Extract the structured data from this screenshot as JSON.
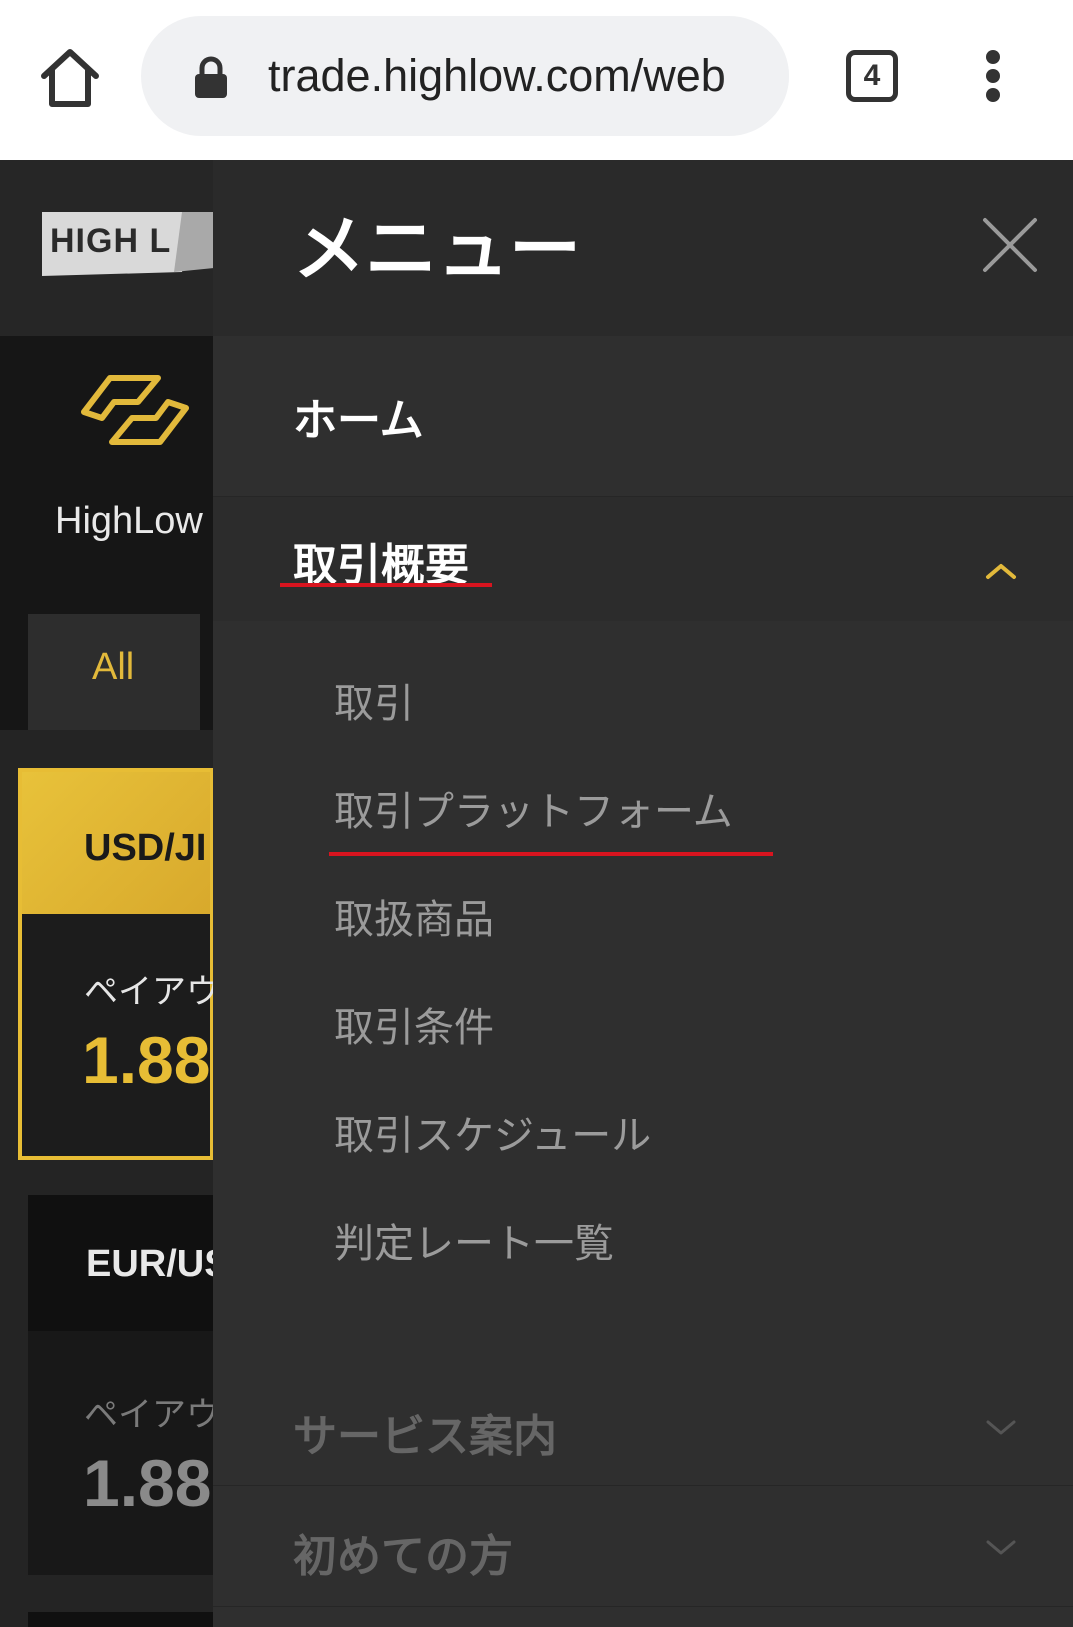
{
  "browser": {
    "url": "trade.highlow.com/web",
    "tab_count": "4"
  },
  "background_page": {
    "logo_text": "HIGH L",
    "hero_title": "HighLow",
    "tab_all": "All",
    "cards": [
      {
        "pair": "USD/JI",
        "payout_label": "ペイアウ",
        "payout_value": "1.88"
      },
      {
        "pair": "EUR/US",
        "payout_label": "ペイアウ",
        "payout_value": "1.88"
      }
    ]
  },
  "menu": {
    "title": "メニュー",
    "items": [
      {
        "label": "ホーム"
      },
      {
        "label": "取引概要",
        "expanded": true,
        "children": [
          "取引",
          "取引プラットフォーム",
          "取扱商品",
          "取引条件",
          "取引スケジュール",
          "判定レート一覧"
        ]
      },
      {
        "label": "サービス案内",
        "expanded": false
      },
      {
        "label": "初めての方",
        "expanded": false
      }
    ]
  },
  "colors": {
    "accent_gold": "#e7bd35",
    "annotation_red": "#d8141f",
    "drawer_bg": "#2f2f2f"
  }
}
